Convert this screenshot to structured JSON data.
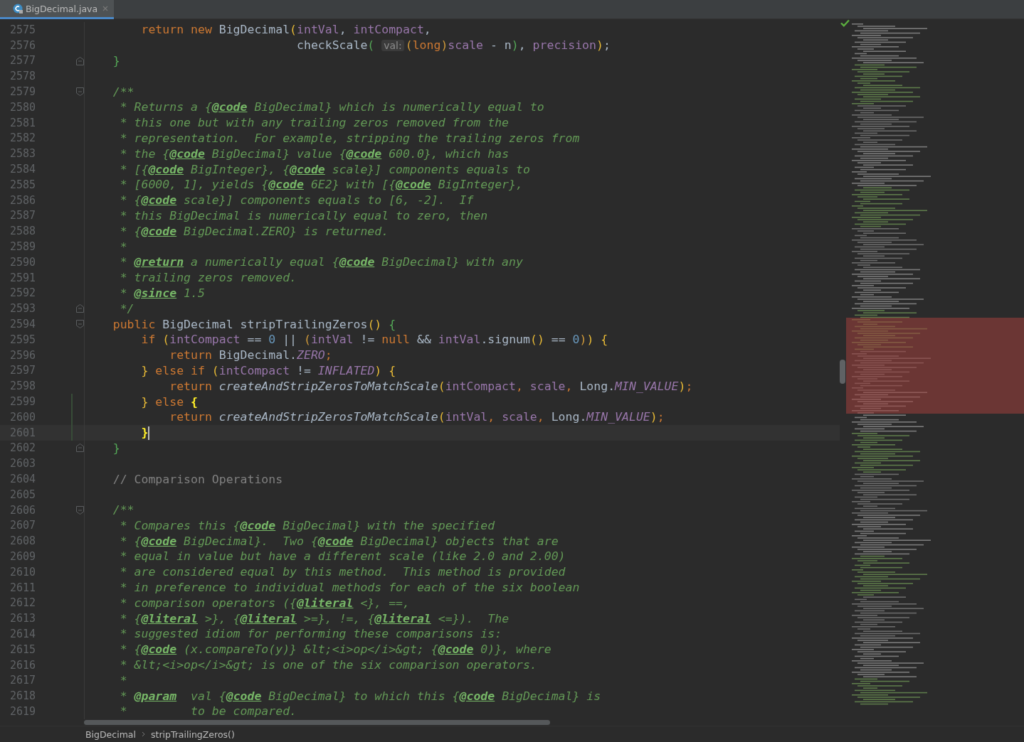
{
  "tab": {
    "label": "BigDecimal.java",
    "selected": true
  },
  "lines": [
    {
      "number": "2575",
      "segments": [
        {
          "kind": "kw",
          "text": "        return new "
        },
        {
          "kind": "id",
          "text": "BigDecimal"
        },
        {
          "kind": "b1",
          "text": "("
        },
        {
          "kind": "fd",
          "text": "intVal"
        },
        {
          "kind": "id",
          "text": ", "
        },
        {
          "kind": "fd",
          "text": "intCompact"
        },
        {
          "kind": "id",
          "text": ","
        }
      ]
    },
    {
      "number": "2576",
      "segments": [
        {
          "kind": "id",
          "text": "                              checkScale"
        },
        {
          "kind": "b2",
          "text": "( "
        },
        {
          "kind": "hint",
          "text": "val:"
        },
        {
          "kind": "b3",
          "text": "("
        },
        {
          "kind": "kw",
          "text": "long"
        },
        {
          "kind": "b3",
          "text": ")"
        },
        {
          "kind": "fd",
          "text": "scale"
        },
        {
          "kind": "id",
          "text": " - n"
        },
        {
          "kind": "b2",
          "text": ")"
        },
        {
          "kind": "id",
          "text": ", "
        },
        {
          "kind": "fd",
          "text": "precision"
        },
        {
          "kind": "b1",
          "text": ")"
        },
        {
          "kind": "id",
          "text": ";"
        }
      ]
    },
    {
      "number": "2577",
      "fold_end": true,
      "segments": [
        {
          "kind": "b2",
          "text": "    }"
        }
      ]
    },
    {
      "number": "2578"
    },
    {
      "number": "2579",
      "fold_start": true,
      "segments": [
        {
          "kind": "dc",
          "text": "    /**"
        }
      ]
    },
    {
      "number": "2580",
      "segments": [
        {
          "kind": "dc",
          "text": "     * Returns a {"
        },
        {
          "kind": "tg",
          "text": "@code"
        },
        {
          "kind": "dc",
          "text": " BigDecimal} which is numerically equal to"
        }
      ]
    },
    {
      "number": "2581",
      "segments": [
        {
          "kind": "dc",
          "text": "     * this one but with any trailing zeros removed from the"
        }
      ]
    },
    {
      "number": "2582",
      "segments": [
        {
          "kind": "dc",
          "text": "     * representation.  For example, stripping the trailing zeros from"
        }
      ]
    },
    {
      "number": "2583",
      "segments": [
        {
          "kind": "dc",
          "text": "     * the {"
        },
        {
          "kind": "tg",
          "text": "@code"
        },
        {
          "kind": "dc",
          "text": " BigDecimal} value {"
        },
        {
          "kind": "tg",
          "text": "@code"
        },
        {
          "kind": "dc",
          "text": " 600.0}, which has"
        }
      ]
    },
    {
      "number": "2584",
      "segments": [
        {
          "kind": "dc",
          "text": "     * [{"
        },
        {
          "kind": "tg",
          "text": "@code"
        },
        {
          "kind": "dc",
          "text": " BigInteger}, {"
        },
        {
          "kind": "tg",
          "text": "@code"
        },
        {
          "kind": "dc",
          "text": " scale}] components equals to"
        }
      ]
    },
    {
      "number": "2585",
      "segments": [
        {
          "kind": "dc",
          "text": "     * [6000, 1], yields {"
        },
        {
          "kind": "tg",
          "text": "@code"
        },
        {
          "kind": "dc",
          "text": " 6E2} with [{"
        },
        {
          "kind": "tg",
          "text": "@code"
        },
        {
          "kind": "dc",
          "text": " BigInteger},"
        }
      ]
    },
    {
      "number": "2586",
      "segments": [
        {
          "kind": "dc",
          "text": "     * {"
        },
        {
          "kind": "tg",
          "text": "@code"
        },
        {
          "kind": "dc",
          "text": " scale}] components equals to [6, -2].  If"
        }
      ]
    },
    {
      "number": "2587",
      "segments": [
        {
          "kind": "dc",
          "text": "     * this BigDecimal is numerically equal to zero, then"
        }
      ]
    },
    {
      "number": "2588",
      "segments": [
        {
          "kind": "dc",
          "text": "     * {"
        },
        {
          "kind": "tg",
          "text": "@code"
        },
        {
          "kind": "dc",
          "text": " BigDecimal.ZERO} is returned."
        }
      ]
    },
    {
      "number": "2589",
      "segments": [
        {
          "kind": "dc",
          "text": "     *"
        }
      ]
    },
    {
      "number": "2590",
      "segments": [
        {
          "kind": "dc",
          "text": "     * "
        },
        {
          "kind": "tg",
          "text": "@return"
        },
        {
          "kind": "dc",
          "text": " a numerically equal {"
        },
        {
          "kind": "tg",
          "text": "@code"
        },
        {
          "kind": "dc",
          "text": " BigDecimal} with any"
        }
      ]
    },
    {
      "number": "2591",
      "segments": [
        {
          "kind": "dc",
          "text": "     * trailing zeros removed."
        }
      ]
    },
    {
      "number": "2592",
      "segments": [
        {
          "kind": "dc",
          "text": "     * "
        },
        {
          "kind": "tg",
          "text": "@since"
        },
        {
          "kind": "dc",
          "text": " 1.5"
        }
      ]
    },
    {
      "number": "2593",
      "fold_end": true,
      "segments": [
        {
          "kind": "dc",
          "text": "     */"
        }
      ]
    },
    {
      "number": "2594",
      "fold_start": true,
      "segments": [
        {
          "kind": "kw",
          "text": "    public "
        },
        {
          "kind": "id",
          "text": "BigDecimal stripTrailingZeros"
        },
        {
          "kind": "b1",
          "text": "() "
        },
        {
          "kind": "b2",
          "text": "{"
        }
      ]
    },
    {
      "number": "2595",
      "segments": [
        {
          "kind": "kw",
          "text": "        if "
        },
        {
          "kind": "b1",
          "text": "("
        },
        {
          "kind": "fd",
          "text": "intCompact"
        },
        {
          "kind": "id",
          "text": " == "
        },
        {
          "kind": "nu",
          "text": "0"
        },
        {
          "kind": "id",
          "text": " || "
        },
        {
          "kind": "b3",
          "text": "("
        },
        {
          "kind": "fd",
          "text": "intVal"
        },
        {
          "kind": "id",
          "text": " != "
        },
        {
          "kind": "kw",
          "text": "null"
        },
        {
          "kind": "id",
          "text": " && "
        },
        {
          "kind": "fd",
          "text": "intVal"
        },
        {
          "kind": "id",
          "text": ".signum"
        },
        {
          "kind": "b1",
          "text": "()"
        },
        {
          "kind": "id",
          "text": " == "
        },
        {
          "kind": "nu",
          "text": "0"
        },
        {
          "kind": "b3",
          "text": ")"
        },
        {
          "kind": "b1",
          "text": ") {"
        }
      ]
    },
    {
      "number": "2596",
      "segments": [
        {
          "kind": "kw",
          "text": "            return "
        },
        {
          "kind": "id",
          "text": "BigDecimal."
        },
        {
          "kind": "st",
          "text": "ZERO"
        },
        {
          "kind": "kw",
          "text": ";"
        }
      ]
    },
    {
      "number": "2597",
      "segments": [
        {
          "kind": "b1",
          "text": "        }"
        },
        {
          "kind": "kw",
          "text": " else if "
        },
        {
          "kind": "b1",
          "text": "("
        },
        {
          "kind": "fd",
          "text": "intCompact"
        },
        {
          "kind": "id",
          "text": " != "
        },
        {
          "kind": "st",
          "text": "INFLATED"
        },
        {
          "kind": "b1",
          "text": ") {"
        }
      ]
    },
    {
      "number": "2598",
      "segments": [
        {
          "kind": "kw",
          "text": "            return "
        },
        {
          "kind": "mi",
          "text": "createAndStripZerosToMatchScale"
        },
        {
          "kind": "b1",
          "text": "("
        },
        {
          "kind": "fd",
          "text": "intCompact"
        },
        {
          "kind": "kw",
          "text": ", "
        },
        {
          "kind": "fd",
          "text": "scale"
        },
        {
          "kind": "kw",
          "text": ", "
        },
        {
          "kind": "id",
          "text": "Long."
        },
        {
          "kind": "st",
          "text": "MIN_VALUE"
        },
        {
          "kind": "b1",
          "text": ")"
        },
        {
          "kind": "kw",
          "text": ";"
        }
      ]
    },
    {
      "number": "2599",
      "changed": true,
      "segments": [
        {
          "kind": "b1",
          "text": "        }"
        },
        {
          "kind": "kw",
          "text": " else "
        },
        {
          "kind": "match",
          "text": "{"
        }
      ]
    },
    {
      "number": "2600",
      "changed": true,
      "segments": [
        {
          "kind": "kw",
          "text": "            return "
        },
        {
          "kind": "mi",
          "text": "createAndStripZerosToMatchScale"
        },
        {
          "kind": "b1",
          "text": "("
        },
        {
          "kind": "fd",
          "text": "intVal"
        },
        {
          "kind": "kw",
          "text": ", "
        },
        {
          "kind": "fd",
          "text": "scale"
        },
        {
          "kind": "kw",
          "text": ", "
        },
        {
          "kind": "id",
          "text": "Long."
        },
        {
          "kind": "st",
          "text": "MIN_VALUE"
        },
        {
          "kind": "b1",
          "text": ")"
        },
        {
          "kind": "kw",
          "text": ";"
        }
      ]
    },
    {
      "number": "2601",
      "current": true,
      "changed": true,
      "segments": [
        {
          "kind": "match",
          "text": "        }"
        }
      ]
    },
    {
      "number": "2602",
      "fold_end": true,
      "segments": [
        {
          "kind": "b2",
          "text": "    }"
        }
      ]
    },
    {
      "number": "2603"
    },
    {
      "number": "2604",
      "segments": [
        {
          "kind": "cm",
          "text": "    // Comparison Operations"
        }
      ]
    },
    {
      "number": "2605"
    },
    {
      "number": "2606",
      "fold_start": true,
      "segments": [
        {
          "kind": "dc",
          "text": "    /**"
        }
      ]
    },
    {
      "number": "2607",
      "segments": [
        {
          "kind": "dc",
          "text": "     * Compares this {"
        },
        {
          "kind": "tg",
          "text": "@code"
        },
        {
          "kind": "dc",
          "text": " BigDecimal} with the specified"
        }
      ]
    },
    {
      "number": "2608",
      "segments": [
        {
          "kind": "dc",
          "text": "     * {"
        },
        {
          "kind": "tg",
          "text": "@code"
        },
        {
          "kind": "dc",
          "text": " BigDecimal}.  Two {"
        },
        {
          "kind": "tg",
          "text": "@code"
        },
        {
          "kind": "dc",
          "text": " BigDecimal} objects that are"
        }
      ]
    },
    {
      "number": "2609",
      "segments": [
        {
          "kind": "dc",
          "text": "     * equal in value but have a different scale (like 2.0 and 2.00)"
        }
      ]
    },
    {
      "number": "2610",
      "segments": [
        {
          "kind": "dc",
          "text": "     * are considered equal by this method.  This method is provided"
        }
      ]
    },
    {
      "number": "2611",
      "segments": [
        {
          "kind": "dc",
          "text": "     * in preference to individual methods for each of the six boolean"
        }
      ]
    },
    {
      "number": "2612",
      "segments": [
        {
          "kind": "dc",
          "text": "     * comparison operators ({"
        },
        {
          "kind": "tg",
          "text": "@literal"
        },
        {
          "kind": "dc",
          "text": " <}, ==,"
        }
      ]
    },
    {
      "number": "2613",
      "segments": [
        {
          "kind": "dc",
          "text": "     * {"
        },
        {
          "kind": "tg",
          "text": "@literal"
        },
        {
          "kind": "dc",
          "text": " >}, {"
        },
        {
          "kind": "tg",
          "text": "@literal"
        },
        {
          "kind": "dc",
          "text": " >=}, !=, {"
        },
        {
          "kind": "tg",
          "text": "@literal"
        },
        {
          "kind": "dc",
          "text": " <=}).  The"
        }
      ]
    },
    {
      "number": "2614",
      "segments": [
        {
          "kind": "dc",
          "text": "     * suggested idiom for performing these comparisons is:"
        }
      ]
    },
    {
      "number": "2615",
      "segments": [
        {
          "kind": "dc",
          "text": "     * {"
        },
        {
          "kind": "tg",
          "text": "@code"
        },
        {
          "kind": "dc",
          "text": " (x.compareTo(y)} &lt;<i>op</i>&gt; {"
        },
        {
          "kind": "tg",
          "text": "@code"
        },
        {
          "kind": "dc",
          "text": " 0)}, where"
        }
      ]
    },
    {
      "number": "2616",
      "segments": [
        {
          "kind": "dc",
          "text": "     * &lt;<i>op</i>&gt; is one of the six comparison operators."
        }
      ]
    },
    {
      "number": "2617",
      "segments": [
        {
          "kind": "dc",
          "text": "     *"
        }
      ]
    },
    {
      "number": "2618",
      "segments": [
        {
          "kind": "dc",
          "text": "     * "
        },
        {
          "kind": "tg",
          "text": "@param"
        },
        {
          "kind": "dc",
          "text": "  val {"
        },
        {
          "kind": "tg",
          "text": "@code"
        },
        {
          "kind": "dc",
          "text": " BigDecimal} to which this {"
        },
        {
          "kind": "tg",
          "text": "@code"
        },
        {
          "kind": "dc",
          "text": " BigDecimal} is"
        }
      ]
    },
    {
      "number": "2619",
      "segments": [
        {
          "kind": "dc",
          "text": "     *         to be compared."
        }
      ]
    }
  ],
  "breadcrumbs": [
    "BigDecimal",
    "stripTrailingZeros()"
  ]
}
